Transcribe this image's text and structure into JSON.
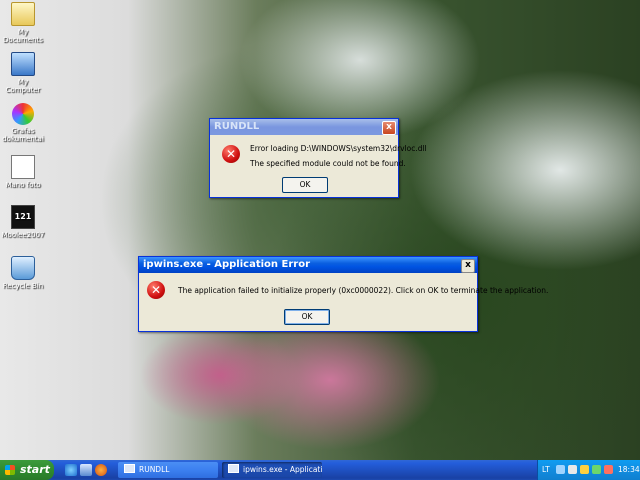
{
  "desktop_icons": [
    {
      "label": "My Documents",
      "icon": "my-documents-icon"
    },
    {
      "label": "My Computer",
      "icon": "my-computer-icon"
    },
    {
      "label": "Grafas\ndokumentai",
      "icon": "opera-icon"
    },
    {
      "label": "Mano foto",
      "icon": "image-file-icon"
    },
    {
      "label": "Moolee2007",
      "icon": "media-player-icon"
    },
    {
      "label": "Recycle Bin",
      "icon": "recycle-bin-icon"
    }
  ],
  "rundll_dialog": {
    "title": "RUNDLL",
    "message_line1": "Error loading D:\\WINDOWS\\system32\\drvloc.dll",
    "message_line2": "The specified module could not be found.",
    "ok_label": "OK",
    "close_glyph": "x"
  },
  "app_error_dialog": {
    "title": "ipwins.exe - Application Error",
    "message": "The application failed to initialize properly (0xc0000022). Click on OK to terminate the application.",
    "ok_label": "OK",
    "close_glyph": "x"
  },
  "taskbar": {
    "start_label": "start",
    "tasks": [
      {
        "label": "RUNDLL"
      },
      {
        "label": "ipwins.exe - Applicati..."
      }
    ],
    "tray": {
      "language": "LT",
      "time": "18:34"
    }
  },
  "colors": {
    "titlebar_active": "#0054e3",
    "taskbar": "#245edb",
    "start_button": "#2f8a2f",
    "error_red": "#d01010"
  }
}
